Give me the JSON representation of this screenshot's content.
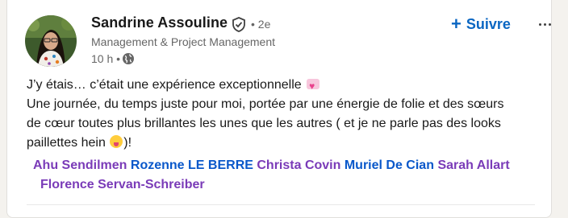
{
  "author": {
    "name": "Sandrine Assouline",
    "connection_degree": "• 2e",
    "headline": "Management & Project Management",
    "time": "10 h •",
    "verified_icon": "shield-check-icon",
    "visibility_icon": "globe-icon",
    "avatar_icon": "profile-photo"
  },
  "actions": {
    "follow_plus": "+",
    "follow_label": "Suivre",
    "more_icon": "more-horizontal-icon"
  },
  "post": {
    "line1": "J’y étais… c’était une expérience exceptionnelle",
    "line2": "Une journée, du temps juste pour moi, portée par une énergie de folie et des sœurs",
    "line3": "de cœur toutes plus brillantes les unes que les autres ( et je ne parle pas des looks",
    "line4_start": "paillettes hein",
    "line4_end": ")!",
    "heart_emoji": "heart-emoji",
    "face_emoji": "face-tongue-emoji"
  },
  "mentions": [
    {
      "name": "Ahu Sendilmen",
      "color": "#7a3bb8"
    },
    {
      "name": "Rozenne LE BERRE",
      "color": "#0a58ca"
    },
    {
      "name": "Christa Covin",
      "color": "#7a3bb8"
    },
    {
      "name": "Muriel De Cian",
      "color": "#0a58ca"
    },
    {
      "name": "Sarah Allart",
      "color": "#7a3bb8"
    },
    {
      "name": "Florence Servan-Schreiber",
      "color": "#7a3bb8"
    }
  ],
  "colors": {
    "accent": "#0a66c2",
    "text": "#191919",
    "muted": "#666666",
    "mention_purple": "#7a3bb8",
    "mention_blue": "#0a58ca"
  }
}
